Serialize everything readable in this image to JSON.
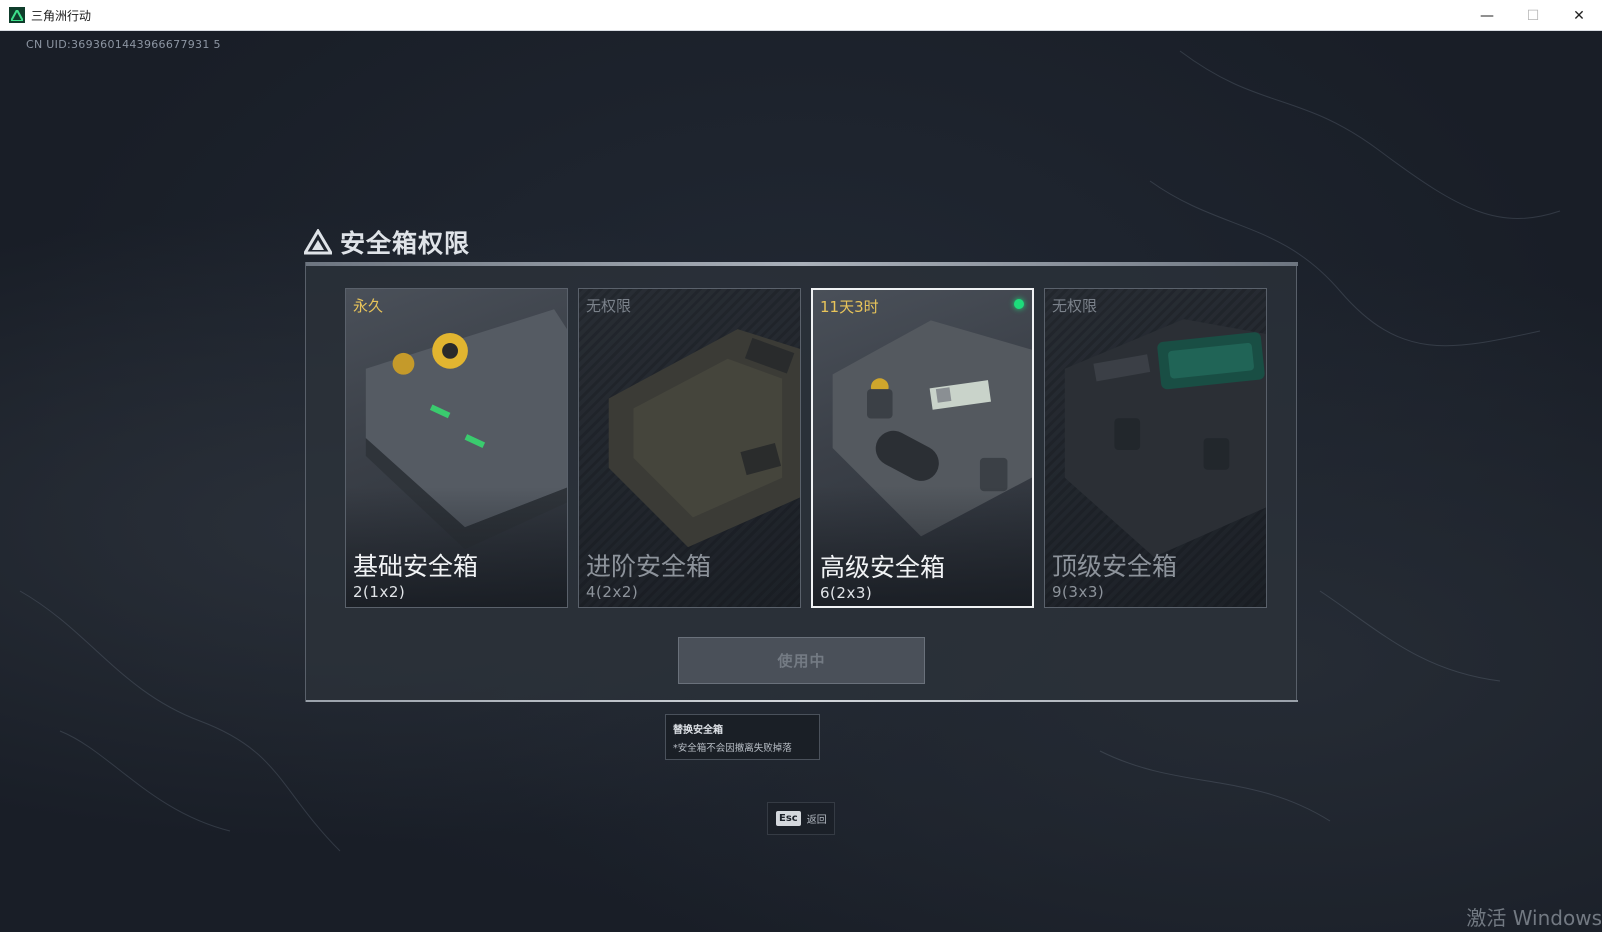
{
  "window": {
    "title": "三角洲行动",
    "controls": {
      "minimize": "—",
      "maximize": "☐",
      "close": "✕"
    }
  },
  "uid": "CN UID:3693601443966677931 5",
  "panel": {
    "title": "安全箱权限",
    "cards": [
      {
        "status": "永久",
        "name": "基础安全箱",
        "size": "2(1x2)",
        "state": "owned"
      },
      {
        "status": "无权限",
        "name": "进阶安全箱",
        "size": "4(2x2)",
        "state": "locked"
      },
      {
        "status": "11天3时",
        "name": "高级安全箱",
        "size": "6(2x3)",
        "state": "selected"
      },
      {
        "status": "无权限",
        "name": "顶级安全箱",
        "size": "9(3x3)",
        "state": "locked"
      }
    ],
    "use_button": "使用中"
  },
  "tooltip": {
    "title": "替换安全箱",
    "text": "*安全箱不会因撤离失败掉落"
  },
  "esc": {
    "key": "Esc",
    "label": "返回"
  },
  "watermark": "激活 Windows",
  "colors": {
    "status_active": "#e8c45a",
    "status_locked": "#7b828b",
    "active_dot": "#1ddc7b",
    "background": "#1b212b"
  }
}
